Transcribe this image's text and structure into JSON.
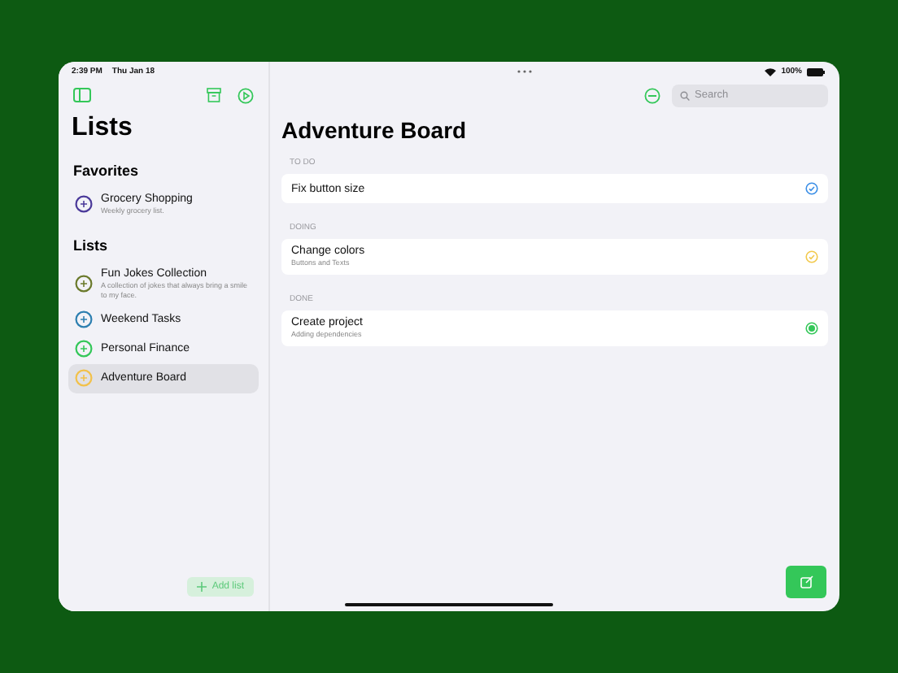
{
  "status_bar": {
    "time": "2:39 PM",
    "date": "Thu Jan 18",
    "battery": "100%"
  },
  "sidebar": {
    "title": "Lists",
    "favorites": {
      "heading": "Favorites",
      "items": [
        {
          "name": "Grocery Shopping",
          "subtitle": "Weekly grocery list.",
          "color": "#4b3a9a",
          "selected": false
        }
      ]
    },
    "lists": {
      "heading": "Lists",
      "items": [
        {
          "name": "Fun Jokes Collection",
          "subtitle": "A collection of jokes that always bring a smile to my face.",
          "color": "#6b7a2c",
          "selected": false
        },
        {
          "name": "Weekend Tasks",
          "color": "#2d7fb0",
          "selected": false
        },
        {
          "name": "Personal Finance",
          "color": "#34c759",
          "selected": false
        },
        {
          "name": "Adventure Board",
          "color": "#f2c14a",
          "selected": true
        }
      ]
    },
    "add_button": "Add list"
  },
  "main": {
    "search": {
      "placeholder": "Search"
    },
    "title": "Adventure Board",
    "sections": [
      {
        "heading": "TO DO",
        "kind": "todo",
        "tasks": [
          {
            "title": "Fix button size"
          }
        ]
      },
      {
        "heading": "DOING",
        "kind": "doing",
        "tasks": [
          {
            "title": "Change colors",
            "subtitle": "Buttons and Texts"
          }
        ]
      },
      {
        "heading": "DONE",
        "kind": "done",
        "tasks": [
          {
            "title": "Create project",
            "subtitle": "Adding dependencies"
          }
        ]
      }
    ]
  }
}
